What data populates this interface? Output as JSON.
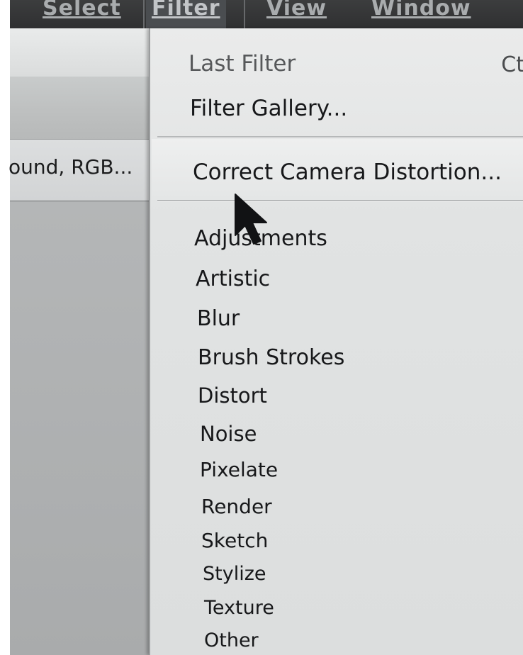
{
  "menubar": {
    "items": [
      "Select",
      "Filter",
      "View",
      "Window"
    ]
  },
  "document": {
    "tab_label": "ound, RGB..."
  },
  "filter_menu": {
    "last_filter": "Last Filter",
    "last_filter_shortcut": "Ct",
    "filter_gallery": "Filter Gallery...",
    "correct_camera_distortion": "Correct Camera Distortion...",
    "submenus": [
      "Adjustments",
      "Artistic",
      "Blur",
      "Brush Strokes",
      "Distort",
      "Noise",
      "Pixelate",
      "Render",
      "Sketch",
      "Stylize",
      "Texture",
      "Other"
    ]
  },
  "icons": {
    "cursor": "arrow-pointer-icon"
  }
}
